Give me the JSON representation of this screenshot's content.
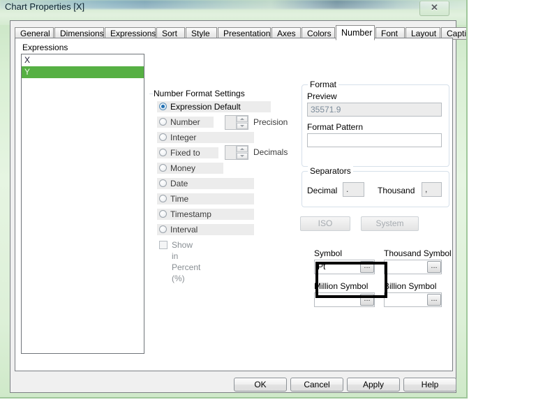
{
  "window": {
    "title": "Chart Properties [X]",
    "close_label": "✕"
  },
  "tabs": [
    {
      "label": "General",
      "selected": false
    },
    {
      "label": "Dimensions",
      "selected": false
    },
    {
      "label": "Expressions",
      "selected": false
    },
    {
      "label": "Sort",
      "selected": false
    },
    {
      "label": "Style",
      "selected": false
    },
    {
      "label": "Presentation",
      "selected": false
    },
    {
      "label": "Axes",
      "selected": false
    },
    {
      "label": "Colors",
      "selected": false
    },
    {
      "label": "Number",
      "selected": true
    },
    {
      "label": "Font",
      "selected": false
    },
    {
      "label": "Layout",
      "selected": false
    },
    {
      "label": "Caption",
      "selected": false
    }
  ],
  "expressions": {
    "label": "Expressions",
    "items": [
      {
        "label": "X",
        "selected": false
      },
      {
        "label": "Y",
        "selected": true
      }
    ]
  },
  "number_format": {
    "group_label": "Number Format Settings",
    "options": [
      {
        "label": "Expression Default",
        "selected": true
      },
      {
        "label": "Number",
        "selected": false
      },
      {
        "label": "Integer",
        "selected": false
      },
      {
        "label": "Fixed to",
        "selected": false
      },
      {
        "label": "Money",
        "selected": false
      },
      {
        "label": "Date",
        "selected": false
      },
      {
        "label": "Time",
        "selected": false
      },
      {
        "label": "Timestamp",
        "selected": false
      },
      {
        "label": "Interval",
        "selected": false
      }
    ],
    "precision_label": "Precision",
    "precision_value": "",
    "decimals_label": "Decimals",
    "decimals_value": "",
    "show_percent_label": "Show in Percent (%)",
    "show_percent_checked": false
  },
  "format": {
    "group_label": "Format",
    "preview_label": "Preview",
    "preview_value": "35571.9",
    "pattern_label": "Format Pattern",
    "pattern_value": ""
  },
  "separators": {
    "group_label": "Separators",
    "decimal_label": "Decimal",
    "decimal_value": ".",
    "thousand_label": "Thousand",
    "thousand_value": ","
  },
  "locale_buttons": {
    "iso_label": "ISO",
    "system_label": "System"
  },
  "symbols": {
    "symbol_label": "Symbol",
    "symbol_value": "Pt",
    "thousand_symbol_label": "Thousand Symbol",
    "thousand_symbol_value": "",
    "million_symbol_label": "Million Symbol",
    "million_symbol_value": "",
    "billion_symbol_label": "Billion Symbol",
    "billion_symbol_value": "",
    "ellipsis_label": "...",
    "highlight_color": "#000000"
  },
  "dialog_buttons": [
    {
      "label": "OK"
    },
    {
      "label": "Cancel"
    },
    {
      "label": "Apply"
    },
    {
      "label": "Help"
    }
  ],
  "colors": {
    "selection_green": "#56b043",
    "window_glass": "#d9efd4",
    "panel": "#f0f0f0"
  }
}
